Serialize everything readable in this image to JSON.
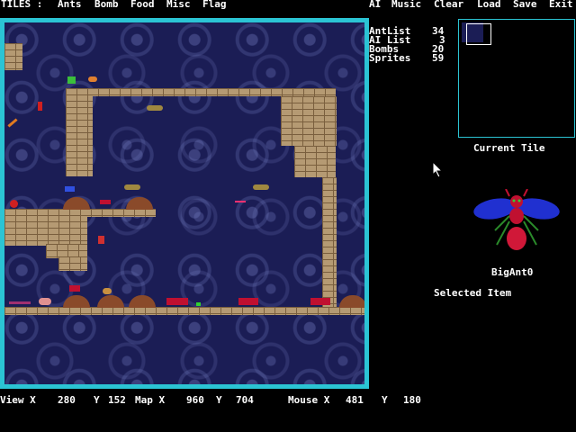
{
  "menu_bar": {
    "tiles_label": "TILES :",
    "left_items": [
      "Ants",
      "Bomb",
      "Food",
      "Misc",
      "Flag"
    ],
    "right_items": [
      "AI",
      "Music",
      "Clear",
      "Load",
      "Save",
      "Exit"
    ]
  },
  "stats": [
    {
      "label": "AntList",
      "value": "34"
    },
    {
      "label": "AI List",
      "value": "3"
    },
    {
      "label": "Bombs",
      "value": "20"
    },
    {
      "label": "Sprites",
      "value": "59"
    }
  ],
  "current_tile": {
    "caption": "Current Tile"
  },
  "selected_item": {
    "name": "BigAnt0",
    "caption": "Selected Item"
  },
  "status_bar": {
    "view_label": "View X",
    "view_x": "280",
    "view_y_label": "Y",
    "view_y": "152",
    "map_label": "Map X",
    "map_x": "960",
    "map_y_label": "Y",
    "map_y": "704",
    "mouse_label": "Mouse X",
    "mouse_x": "481",
    "mouse_y_label": "Y",
    "mouse_y": "180"
  },
  "colors": {
    "frame": "#2bc4d4",
    "map_background": "#1b1d55",
    "brick": "#b59a73",
    "mound": "#8a4a2a",
    "text": "#ffffff"
  },
  "icons": {
    "ant": "bigant-icon",
    "cursor": "arrow-cursor-icon"
  }
}
